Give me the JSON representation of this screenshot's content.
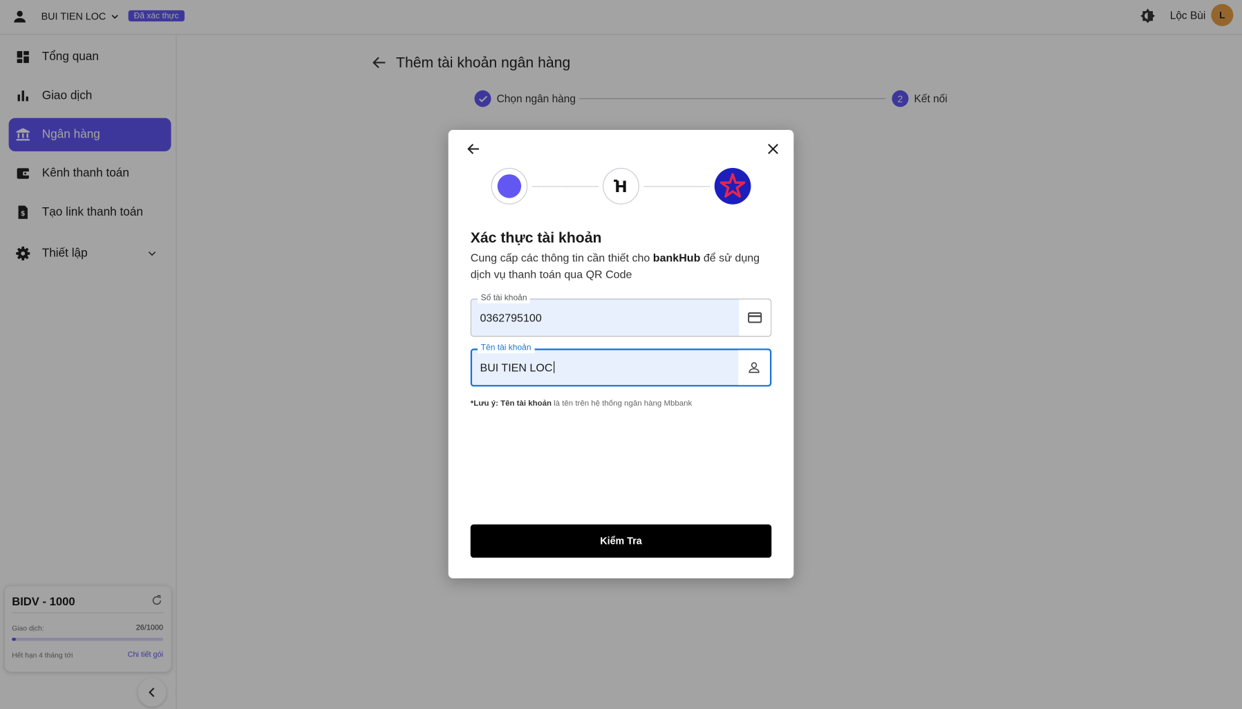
{
  "header": {
    "username": "BUI TIEN LOC",
    "verified_badge": "Đã xác thực",
    "profile_name": "Lộc Bùi",
    "avatar_initial": "L"
  },
  "sidebar": {
    "items": [
      {
        "label": "Tổng quan",
        "icon": "dashboard-icon"
      },
      {
        "label": "Giao dịch",
        "icon": "bar-chart-icon"
      },
      {
        "label": "Ngân hàng",
        "icon": "bank-icon",
        "active": true
      },
      {
        "label": "Kênh thanh toán",
        "icon": "wallet-icon"
      },
      {
        "label": "Tạo link thanh toán",
        "icon": "invoice-icon"
      },
      {
        "label": "Thiết lập",
        "icon": "gear-icon",
        "expandable": true
      }
    ],
    "plan": {
      "title": "BIDV - 1000",
      "transactions_label": "Giao dịch:",
      "transactions_count": "26/1000",
      "progress_fraction": 0.026,
      "expiry": "Hết hạn 4 tháng tới",
      "details_link": "Chi tiết gói"
    }
  },
  "page": {
    "title": "Thêm tài khoản ngân hàng",
    "steps": [
      {
        "label": "Chọn ngân hàng",
        "status": "done"
      },
      {
        "label": "Kết nối",
        "number": "2",
        "status": "active"
      }
    ]
  },
  "modal": {
    "logo_b_text": "H",
    "title": "Xác thực tài khoản",
    "desc_before": "Cung cấp các thông tin cần thiết cho ",
    "desc_brand": "bankHub",
    "desc_after": " để sử dụng dịch vụ thanh toán qua QR Code",
    "fields": {
      "account_number": {
        "label": "Số tài khoản",
        "value": "0362795100"
      },
      "account_name": {
        "label": "Tên tài khoản",
        "value": "BUI TIEN LOC"
      }
    },
    "note_prefix": "*Lưu ý: Tên tài khoản",
    "note_rest": " là tên trên hệ thống ngân hàng Mbbank",
    "submit_label": "Kiểm Tra"
  },
  "colors": {
    "accent": "#6257f2",
    "focus_border": "#1976d2",
    "button": "#000000",
    "bank_logo_bg": "#1b1fbd",
    "bank_logo_star": "#e8264a"
  }
}
